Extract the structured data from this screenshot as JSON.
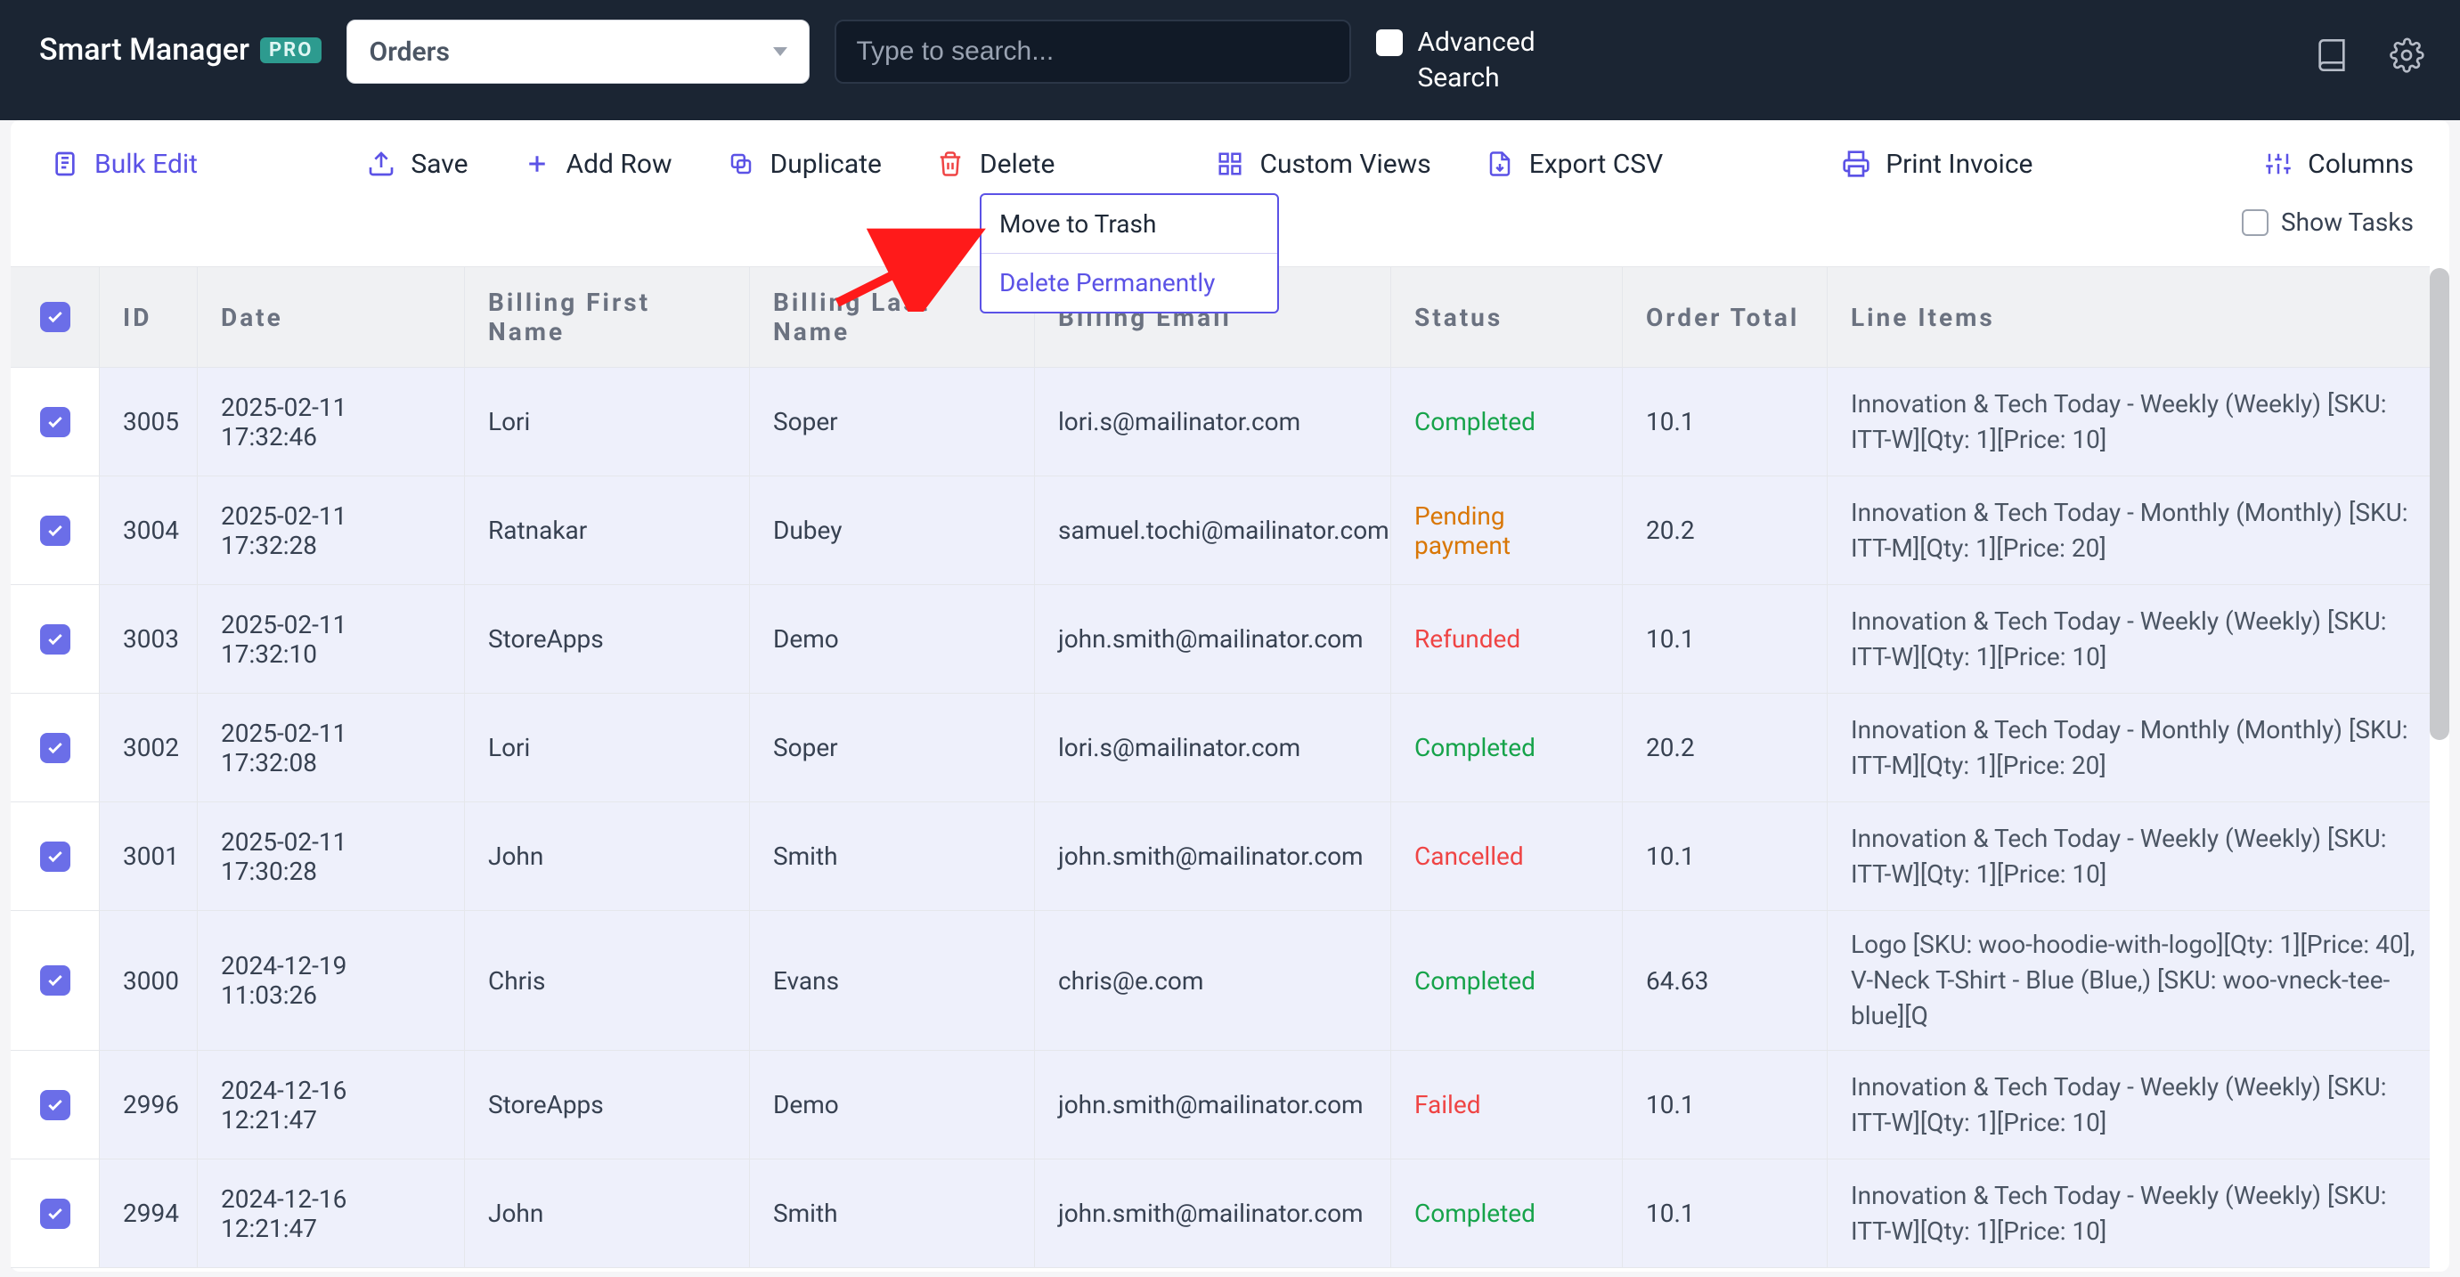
{
  "header": {
    "brand": "Smart Manager",
    "pro": "PRO",
    "entity_select": "Orders",
    "search_placeholder": "Type to search...",
    "advanced_label_1": "Advanced",
    "advanced_label_2": "Search"
  },
  "toolbar": {
    "bulk_edit": "Bulk Edit",
    "save": "Save",
    "add_row": "Add Row",
    "duplicate": "Duplicate",
    "delete": "Delete",
    "custom_views": "Custom Views",
    "export_csv": "Export CSV",
    "print_invoice": "Print Invoice",
    "columns": "Columns",
    "show_tasks": "Show Tasks"
  },
  "delete_menu": {
    "move_to_trash": "Move to Trash",
    "delete_permanently": "Delete Permanently"
  },
  "columns": {
    "id": "ID",
    "date": "Date",
    "bfn": "Billing First Name",
    "bln": "Billing Last Name",
    "bem": "Billing Email",
    "status": "Status",
    "total": "Order Total",
    "line_items": "Line Items"
  },
  "rows": [
    {
      "id": "3005",
      "date": "2025-02-11 17:32:46",
      "bfn": "Lori",
      "bln": "Soper",
      "bem": "lori.s@mailinator.com",
      "status": "Completed",
      "status_class": "status-completed",
      "total": "10.1",
      "line": "Innovation & Tech Today - Weekly (Weekly) [SKU: ITT-W][Qty: 1][Price: 10]"
    },
    {
      "id": "3004",
      "date": "2025-02-11 17:32:28",
      "bfn": "Ratnakar",
      "bln": "Dubey",
      "bem": "samuel.tochi@mailinator.com",
      "status": "Pending payment",
      "status_class": "status-pending",
      "total": "20.2",
      "line": "Innovation & Tech Today - Monthly (Monthly) [SKU: ITT-M][Qty: 1][Price: 20]"
    },
    {
      "id": "3003",
      "date": "2025-02-11 17:32:10",
      "bfn": "StoreApps",
      "bln": "Demo",
      "bem": "john.smith@mailinator.com",
      "status": "Refunded",
      "status_class": "status-refunded",
      "total": "10.1",
      "line": "Innovation & Tech Today - Weekly (Weekly) [SKU: ITT-W][Qty: 1][Price: 10]"
    },
    {
      "id": "3002",
      "date": "2025-02-11 17:32:08",
      "bfn": "Lori",
      "bln": "Soper",
      "bem": "lori.s@mailinator.com",
      "status": "Completed",
      "status_class": "status-completed",
      "total": "20.2",
      "line": "Innovation & Tech Today - Monthly (Monthly) [SKU: ITT-M][Qty: 1][Price: 20]"
    },
    {
      "id": "3001",
      "date": "2025-02-11 17:30:28",
      "bfn": "John",
      "bln": "Smith",
      "bem": "john.smith@mailinator.com",
      "status": "Cancelled",
      "status_class": "status-cancelled",
      "total": "10.1",
      "line": "Innovation & Tech Today - Weekly (Weekly) [SKU: ITT-W][Qty: 1][Price: 10]"
    },
    {
      "id": "3000",
      "date": "2024-12-19 11:03:26",
      "bfn": "Chris",
      "bln": "Evans",
      "bem": "chris@e.com",
      "status": "Completed",
      "status_class": "status-completed",
      "total": "64.63",
      "line": "Logo [SKU: woo-hoodie-with-logo][Qty: 1][Price: 40], V-Neck T-Shirt - Blue (Blue,) [SKU: woo-vneck-tee-blue][Q"
    },
    {
      "id": "2996",
      "date": "2024-12-16 12:21:47",
      "bfn": "StoreApps",
      "bln": "Demo",
      "bem": "john.smith@mailinator.com",
      "status": "Failed",
      "status_class": "status-failed",
      "total": "10.1",
      "line": "Innovation & Tech Today - Weekly (Weekly) [SKU: ITT-W][Qty: 1][Price: 10]"
    },
    {
      "id": "2994",
      "date": "2024-12-16 12:21:47",
      "bfn": "John",
      "bln": "Smith",
      "bem": "john.smith@mailinator.com",
      "status": "Completed",
      "status_class": "status-completed",
      "total": "10.1",
      "line": "Innovation & Tech Today - Weekly (Weekly) [SKU: ITT-W][Qty: 1][Price: 10]"
    }
  ]
}
